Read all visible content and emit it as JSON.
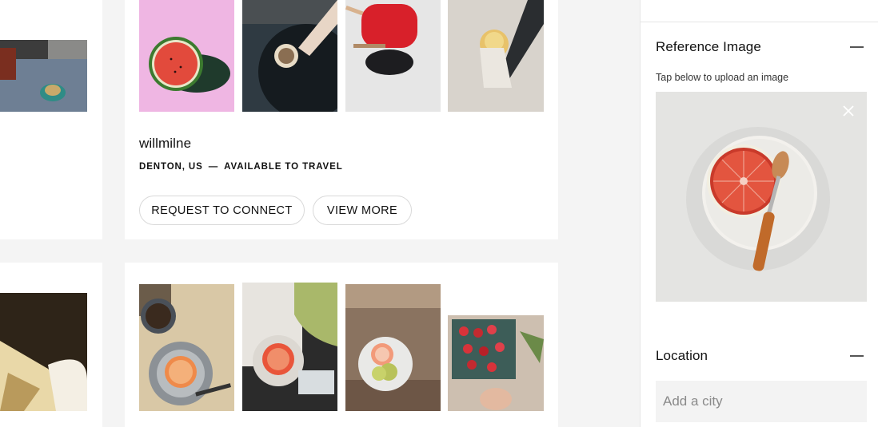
{
  "profile": {
    "username": "willmilne",
    "location": "DENTON, US",
    "availability": "AVAILABLE TO TRAVEL",
    "separator": "—",
    "connect_label": "REQUEST TO CONNECT",
    "view_more_label": "VIEW MORE"
  },
  "sidebar": {
    "reference": {
      "title": "Reference Image",
      "hint": "Tap below to upload an image"
    },
    "location": {
      "title": "Location",
      "placeholder": "Add a city"
    }
  },
  "icons": {
    "collapse": "minus-icon",
    "remove": "close-icon"
  },
  "colors": {
    "background": "#f4f4f4",
    "card": "#ffffff",
    "pill_border": "#d9d9d9",
    "input_bg": "#f3f3f3"
  }
}
